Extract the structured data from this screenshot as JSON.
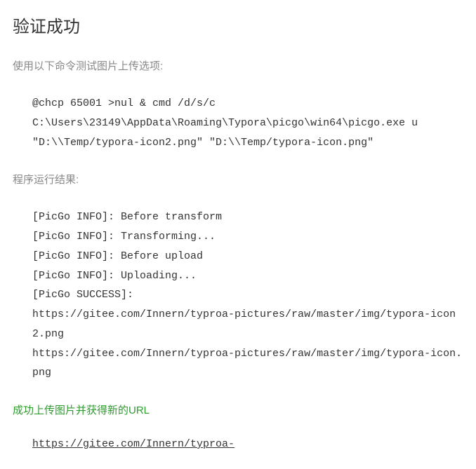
{
  "title": "验证成功",
  "section1_label": "使用以下命令测试图片上传选项:",
  "command_block": "@chcp 65001 >nul & cmd /d/s/c\nC:\\Users\\23149\\AppData\\Roaming\\Typora\\picgo\\win64\\picgo.exe u\n\"D:\\\\Temp/typora-icon2.png\" \"D:\\\\Temp/typora-icon.png\"",
  "section2_label": "程序运行结果:",
  "output_block": "[PicGo INFO]: Before transform\n[PicGo INFO]: Transforming...\n[PicGo INFO]: Before upload\n[PicGo INFO]: Uploading...\n[PicGo SUCCESS]:\nhttps://gitee.com/Innern/typroa-pictures/raw/master/img/typora-icon2.png\nhttps://gitee.com/Innern/typroa-pictures/raw/master/img/typora-icon.png",
  "success_message": "成功上传图片并获得新的URL",
  "result_url": "https://gitee.com/Innern/typroa-"
}
